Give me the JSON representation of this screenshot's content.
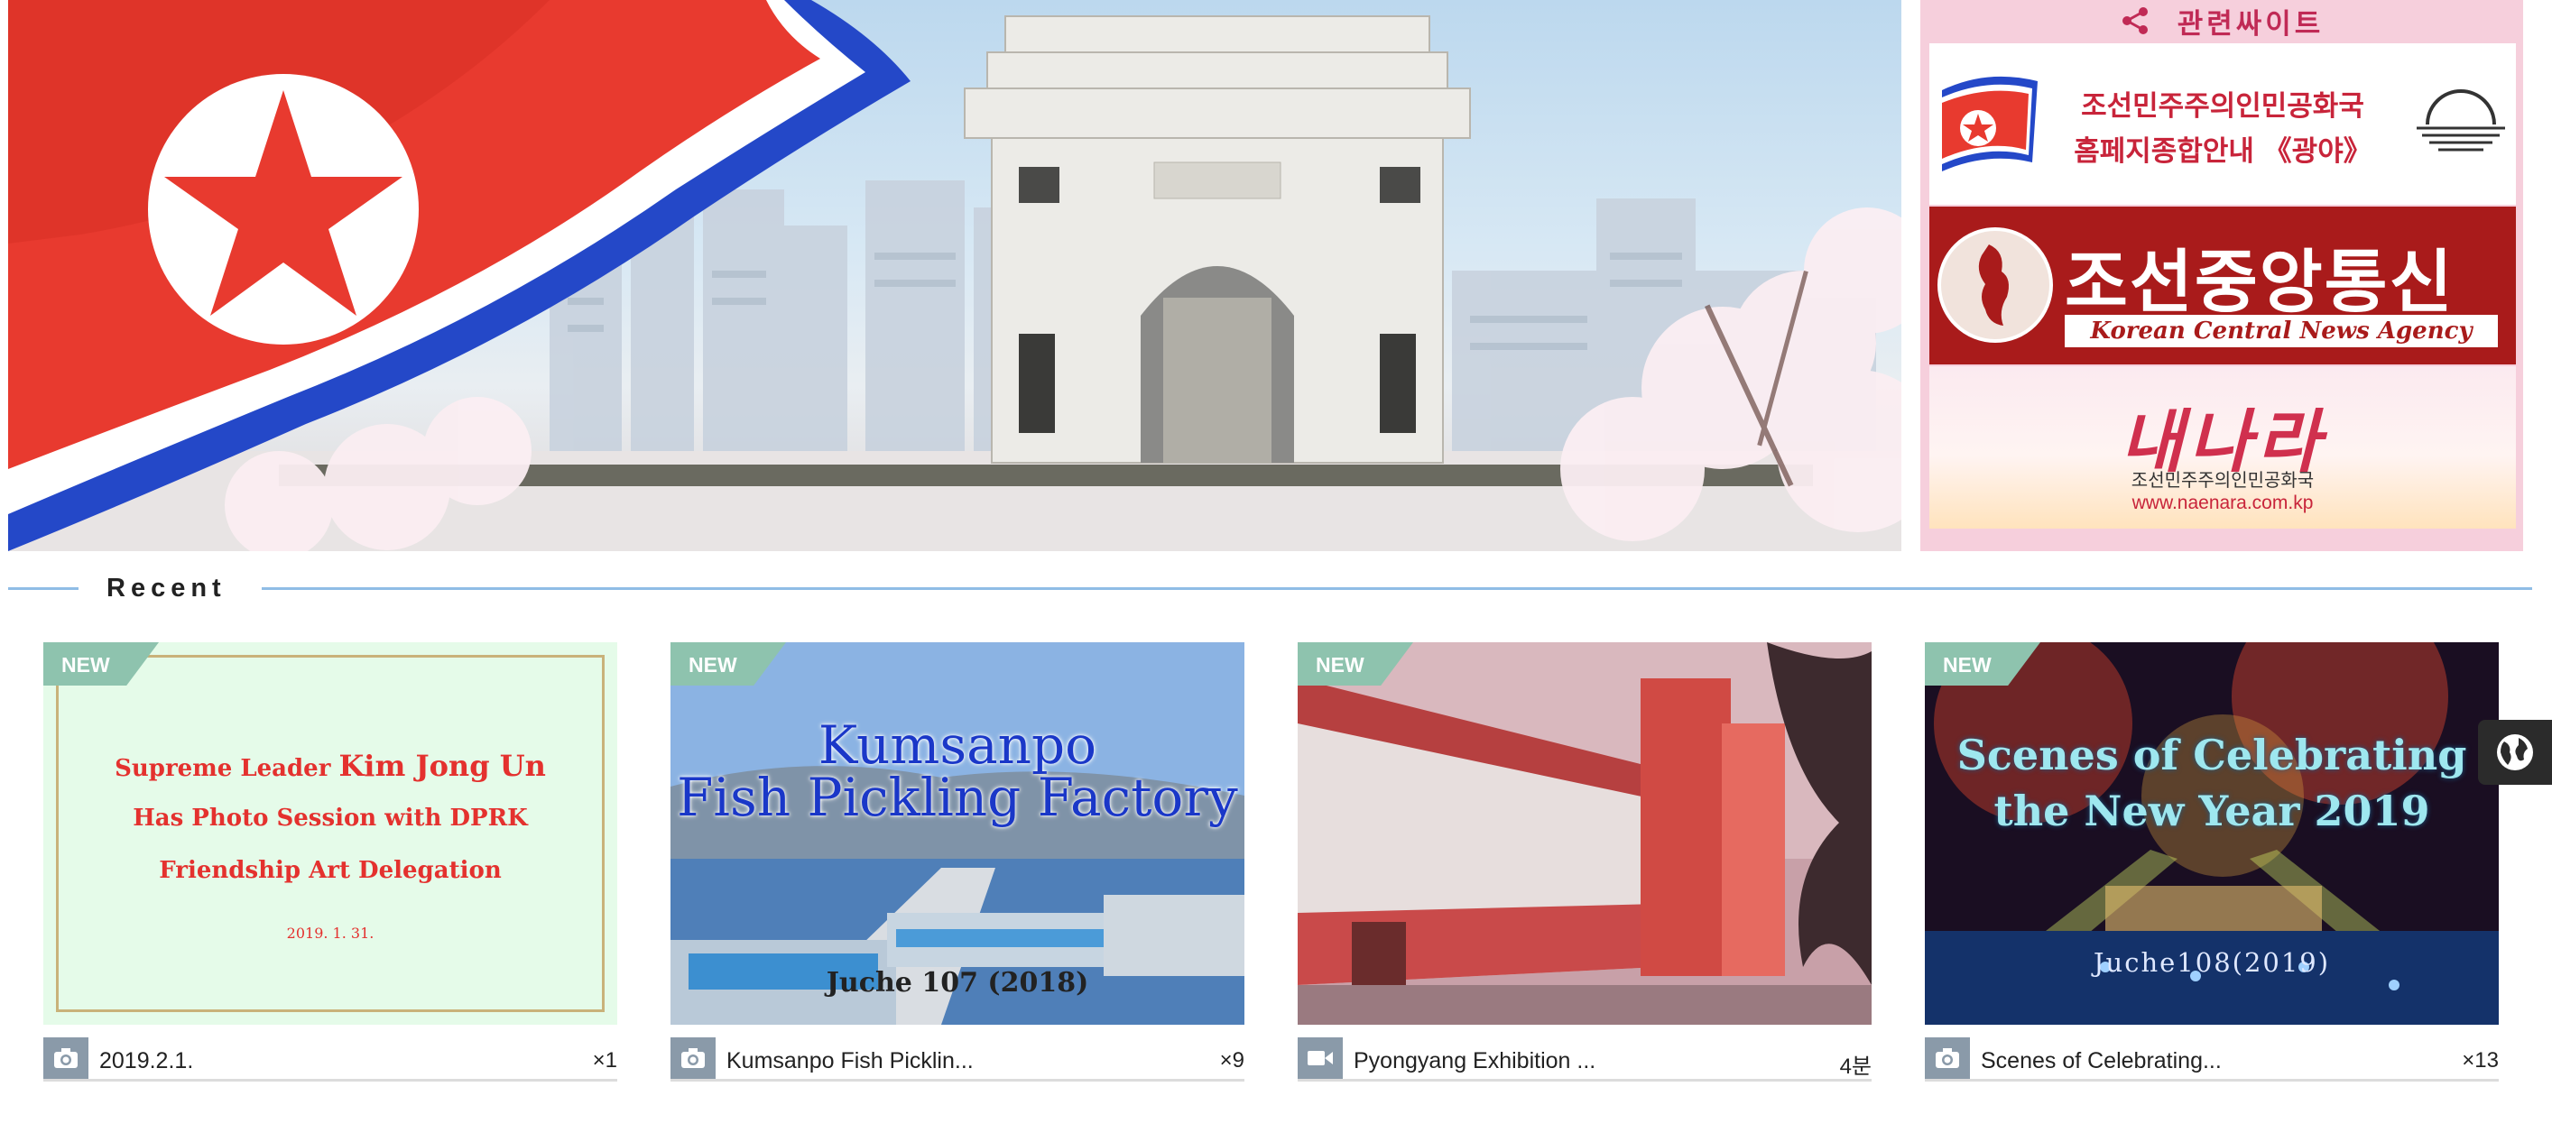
{
  "hero": {
    "alt": "Arch of Triumph with national flag",
    "colors": {
      "flag_red": "#e83a2f",
      "flag_blue": "#2448c8",
      "sky": "#bcd8ee"
    }
  },
  "related_sites": {
    "title": "관련싸이트",
    "icon": "share-icon",
    "items": [
      {
        "lines": [
          "조선민주주의인민공화국",
          "홈페지종합안내 《광야》"
        ]
      },
      {
        "title": "조선중앙통신",
        "subtitle": "Korean Central News Agency"
      },
      {
        "title": "내나라",
        "org": "조선민주주의인민공화국",
        "url": "www.naenara.com.kp"
      }
    ]
  },
  "recent": {
    "title": "Recent",
    "items": [
      {
        "badge": "NEW",
        "thumb_lines": [
          "Supreme Leader",
          "Kim Jong Un",
          "Has Photo Session with DPRK",
          "Friendship Art Delegation",
          "2019. 1. 31."
        ],
        "media_icon": "camera-icon",
        "caption": "2019.2.1.",
        "count": "×1"
      },
      {
        "badge": "NEW",
        "thumb_lines": [
          "Kumsanpo",
          "Fish Pickling Factory",
          "Juche 107 (2018)"
        ],
        "media_icon": "camera-icon",
        "caption": "Kumsanpo Fish Picklin...",
        "count": "×9"
      },
      {
        "badge": "NEW",
        "thumb_lines": [],
        "media_icon": "video-camera-icon",
        "caption": "Pyongyang Exhibition ...",
        "count": "4분"
      },
      {
        "badge": "NEW",
        "thumb_lines": [
          "Scenes of Celebrating",
          "the New Year 2019",
          "Juche108(2019)"
        ],
        "media_icon": "camera-icon",
        "caption": "Scenes of Celebrating...",
        "count": "×13"
      }
    ]
  },
  "floating": {
    "icon": "globe-icon"
  }
}
